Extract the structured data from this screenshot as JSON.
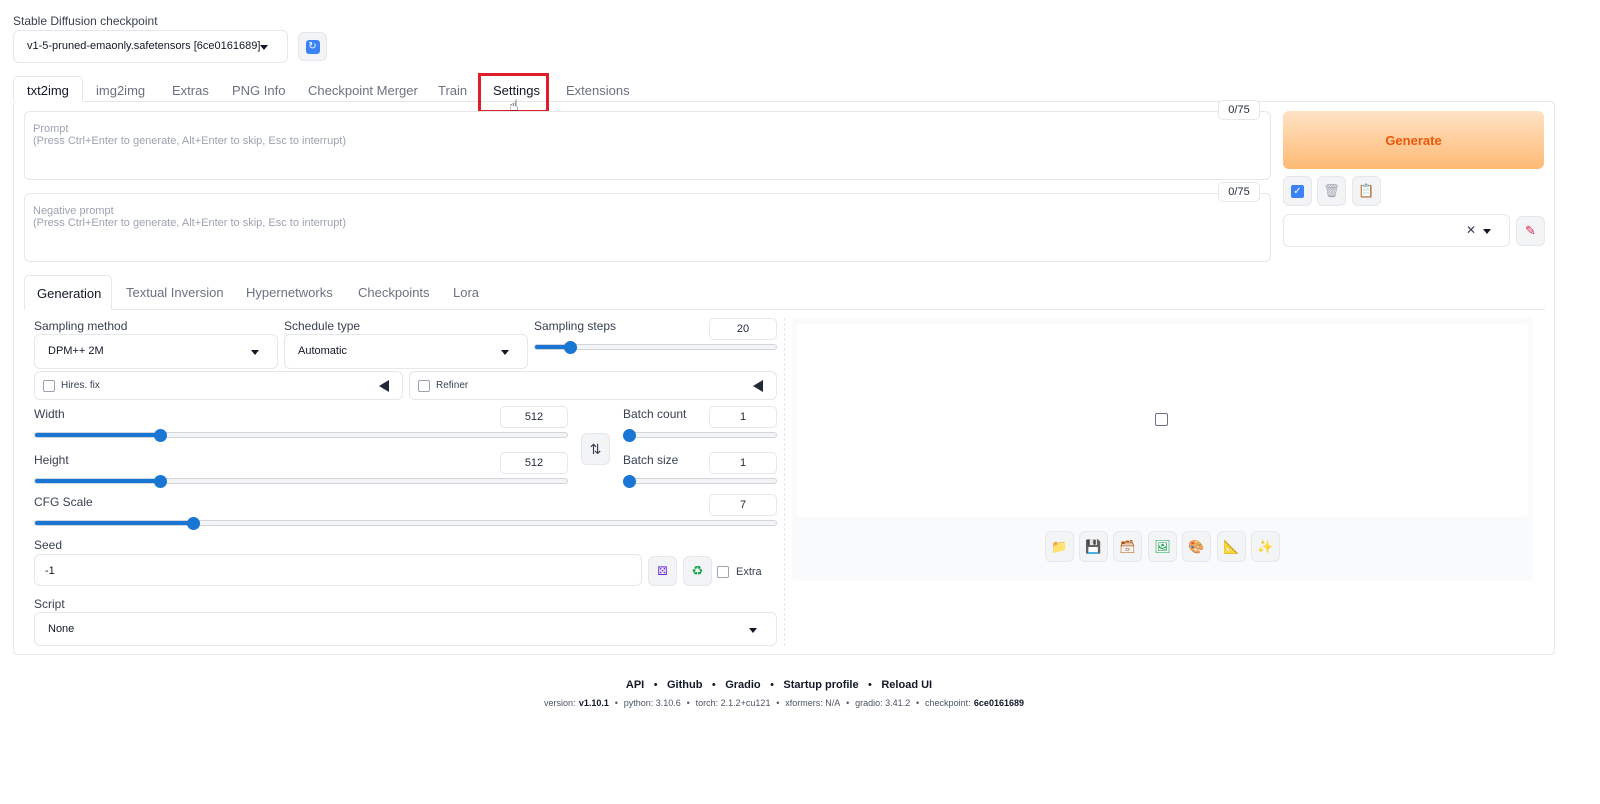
{
  "checkpoint": {
    "label": "Stable Diffusion checkpoint",
    "value": "v1-5-pruned-emaonly.safetensors [6ce0161689]"
  },
  "main_tabs": [
    "txt2img",
    "img2img",
    "Extras",
    "PNG Info",
    "Checkpoint Merger",
    "Train",
    "Settings",
    "Extensions"
  ],
  "prompt": {
    "label": "Prompt",
    "placeholder": "(Press Ctrl+Enter to generate, Alt+Enter to skip, Esc to interrupt)",
    "token_count": "0/75"
  },
  "negative_prompt": {
    "label": "Negative prompt",
    "placeholder": "(Press Ctrl+Enter to generate, Alt+Enter to skip, Esc to interrupt)",
    "token_count": "0/75"
  },
  "generate_label": "Generate",
  "sub_tabs": [
    "Generation",
    "Textual Inversion",
    "Hypernetworks",
    "Checkpoints",
    "Lora"
  ],
  "sampling_method": {
    "label": "Sampling method",
    "value": "DPM++ 2M"
  },
  "schedule_type": {
    "label": "Schedule type",
    "value": "Automatic"
  },
  "sampling_steps": {
    "label": "Sampling steps",
    "value": "20",
    "fraction": 0.13
  },
  "hires_fix_label": "Hires. fix",
  "refiner_label": "Refiner",
  "width": {
    "label": "Width",
    "value": "512",
    "fraction": 0.23
  },
  "height": {
    "label": "Height",
    "value": "512",
    "fraction": 0.23
  },
  "batch_count": {
    "label": "Batch count",
    "value": "1",
    "fraction": 0.0
  },
  "batch_size": {
    "label": "Batch size",
    "value": "1",
    "fraction": 0.0
  },
  "cfg_scale": {
    "label": "CFG Scale",
    "value": "7",
    "fraction": 0.21
  },
  "seed": {
    "label": "Seed",
    "value": "-1",
    "extra_label": "Extra"
  },
  "script": {
    "label": "Script",
    "value": "None"
  },
  "footer": {
    "links": [
      "API",
      "Github",
      "Gradio",
      "Startup profile",
      "Reload UI"
    ],
    "version_label": "version:",
    "version": "v1.10.1",
    "python": "python: 3.10.6",
    "torch": "torch: 2.1.2+cu121",
    "xformers": "xformers: N/A",
    "gradio": "gradio: 3.41.2",
    "checkpoint_label": "checkpoint:",
    "checkpoint": "6ce0161689"
  },
  "colors": {
    "accent_blue": "#1976d2",
    "generate_text": "#ea580c",
    "highlight_red": "#e11d2a"
  },
  "icons": [
    "refresh-icon",
    "checkbox-style-icon",
    "trash-icon",
    "clipboard-icon",
    "pencil-icon",
    "swap-icon",
    "dice-icon",
    "recycle-icon",
    "image-placeholder-icon",
    "folder-icon",
    "save-icon",
    "zip-icon",
    "image-icon",
    "palette-icon",
    "ruler-icon",
    "sparkle-icon",
    "pointer-hand-icon"
  ]
}
